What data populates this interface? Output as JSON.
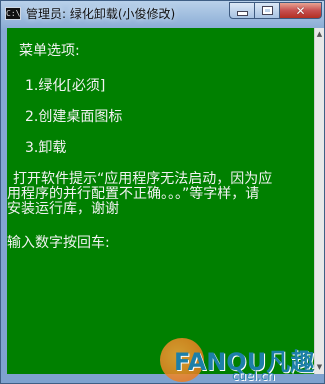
{
  "window": {
    "icon_text": "C:\\",
    "title": "管理员: 绿化卸载(小俊修改)",
    "close_glyph": "✕"
  },
  "console": {
    "lines": [
      "菜单选项:",
      "1.绿化[必须]",
      "2.创建桌面图标",
      "3.卸载",
      "打开软件提示“应用程序无法启动，因为应",
      "用程序的并行配置不正确。。。”等字样，请",
      "安装运行库，谢谢",
      "输入数字按回车:"
    ]
  },
  "watermark": {
    "brand": "FANQU凡趣",
    "domain": "cuel.cn"
  },
  "colors": {
    "console_bg": "#008000",
    "console_text": "#f2f2f2"
  }
}
